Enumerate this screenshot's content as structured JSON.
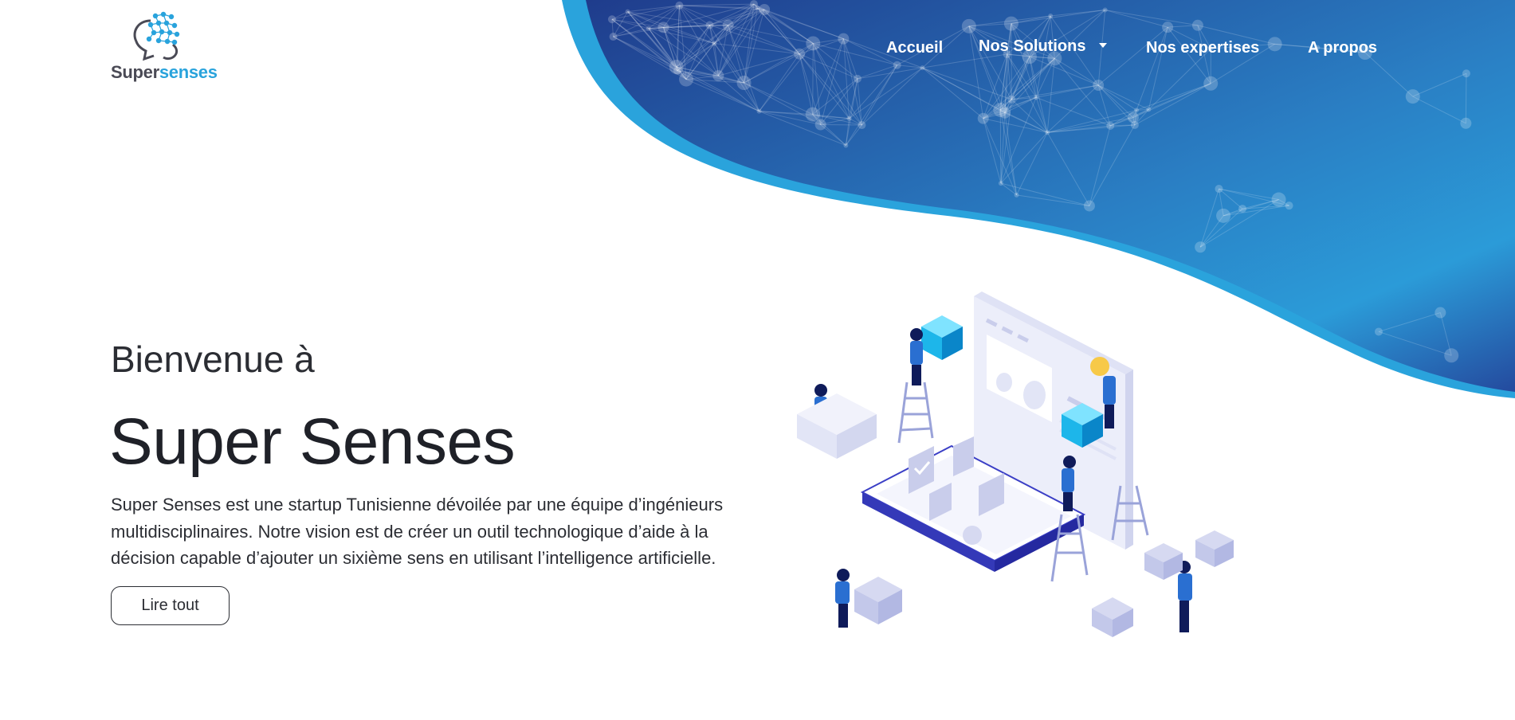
{
  "colors": {
    "wave_dark": "#1d3f8f",
    "wave_light": "#2aa3dc",
    "brand_grey": "#4a4a55",
    "brand_blue": "#29a3dc",
    "text": "#212529"
  },
  "logo": {
    "word_part1": "Super",
    "word_part2": "senses",
    "icon": "brain-head-icon"
  },
  "nav": {
    "items": [
      {
        "label": "Accueil"
      },
      {
        "label": "Nos Solutions",
        "has_dropdown": true
      },
      {
        "label": "Nos expertises"
      },
      {
        "label": "A propos"
      }
    ]
  },
  "hero": {
    "subtitle": "Bienvenue à",
    "title": "Super Senses",
    "description": "Super Senses est une startup Tunisienne dévoilée par une équipe d’ingénieurs multidisciplinaires. Notre vision est de créer un outil technologique d’aide à la décision capable d’ajouter un sixième sens en utilisant l’intelligence artificielle.",
    "button_label": "Lire tout"
  },
  "illustration": {
    "icon": "isometric-team-illustration"
  }
}
